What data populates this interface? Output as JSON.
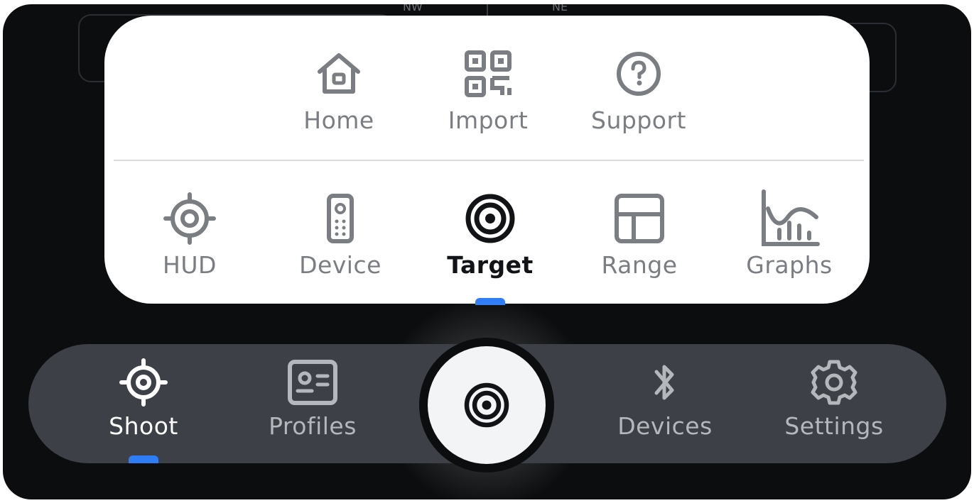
{
  "compass": {
    "nw": "NW",
    "ne": "NE"
  },
  "popup_menu": {
    "top_row": [
      {
        "label": "Home",
        "icon": "home-icon"
      },
      {
        "label": "Import",
        "icon": "qr-code-icon"
      },
      {
        "label": "Support",
        "icon": "help-circle-icon"
      }
    ],
    "bottom_row": [
      {
        "label": "HUD",
        "icon": "crosshair-icon"
      },
      {
        "label": "Device",
        "icon": "remote-device-icon"
      },
      {
        "label": "Target",
        "icon": "target-icon",
        "active": true
      },
      {
        "label": "Range",
        "icon": "grid-icon"
      },
      {
        "label": "Graphs",
        "icon": "chart-icon"
      }
    ]
  },
  "tab_bar": {
    "items": [
      {
        "label": "Shoot",
        "icon": "crosshair-icon",
        "active": true
      },
      {
        "label": "Profiles",
        "icon": "profile-card-icon"
      },
      {
        "label": "Devices",
        "icon": "bluetooth-icon"
      },
      {
        "label": "Settings",
        "icon": "gear-icon"
      }
    ],
    "center_button_icon": "target-icon"
  },
  "colors": {
    "accent": "#2f7df6",
    "frame_background": "#0c0d0f",
    "nav_background": "#3d4046",
    "popup_background": "#ffffff",
    "inactive_text_light": "#7a7d82",
    "inactive_text_dark": "#b4b7bc"
  }
}
